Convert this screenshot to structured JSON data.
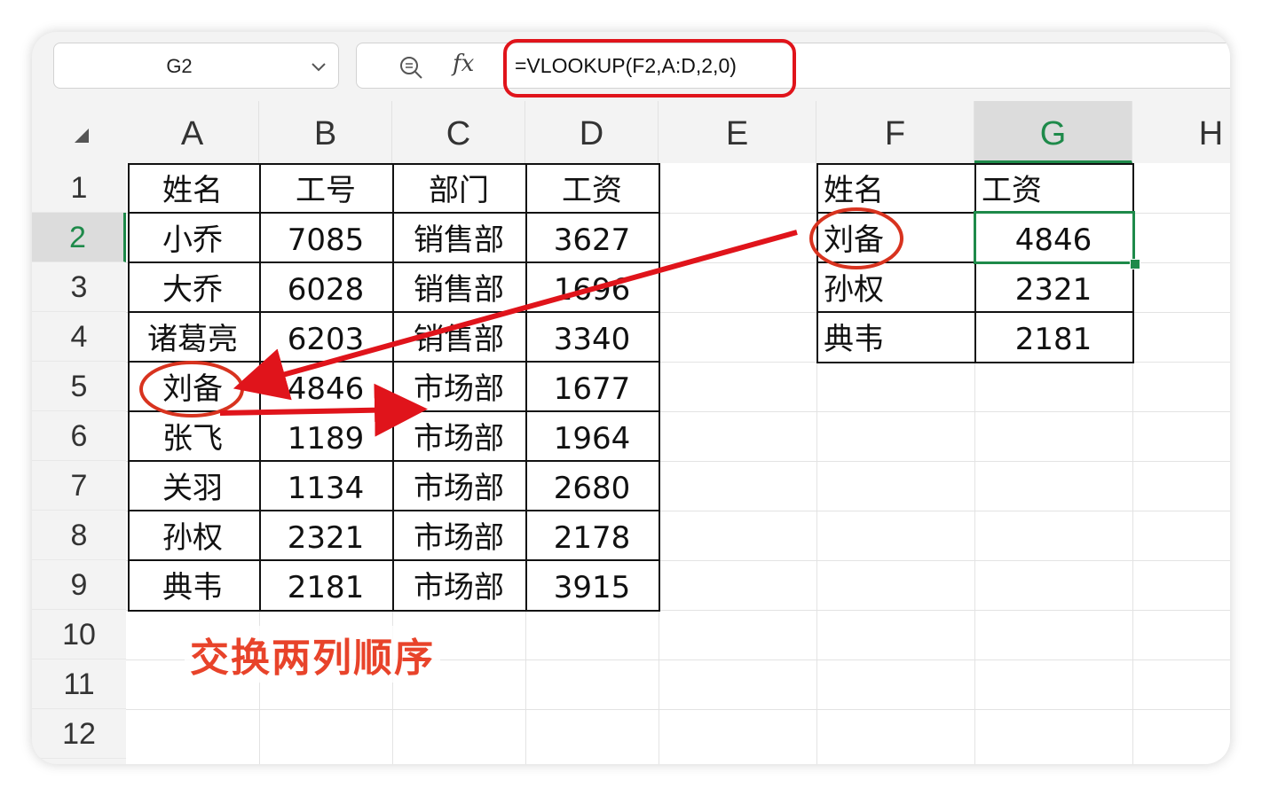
{
  "name_box": {
    "value": "G2"
  },
  "formula_bar": {
    "fx_label": "fx",
    "formula": "=VLOOKUP(F2,A:D,2,0)"
  },
  "columns": [
    {
      "label": "A"
    },
    {
      "label": "B"
    },
    {
      "label": "C"
    },
    {
      "label": "D"
    },
    {
      "label": "E"
    },
    {
      "label": "F"
    },
    {
      "label": "G"
    },
    {
      "label": "H"
    }
  ],
  "rows": [
    "1",
    "2",
    "3",
    "4",
    "5",
    "6",
    "7",
    "8",
    "9",
    "10",
    "11",
    "12"
  ],
  "active_cell": {
    "column": "G",
    "row": "2"
  },
  "left_table": {
    "headers": [
      "姓名",
      "工号",
      "部门",
      "工资"
    ],
    "rows": [
      [
        "小乔",
        "7085",
        "销售部",
        "3627"
      ],
      [
        "大乔",
        "6028",
        "销售部",
        "1696"
      ],
      [
        "诸葛亮",
        "6203",
        "销售部",
        "3340"
      ],
      [
        "刘备",
        "4846",
        "市场部",
        "1677"
      ],
      [
        "张飞",
        "1189",
        "市场部",
        "1964"
      ],
      [
        "关羽",
        "1134",
        "市场部",
        "2680"
      ],
      [
        "孙权",
        "2321",
        "市场部",
        "2178"
      ],
      [
        "典韦",
        "2181",
        "市场部",
        "3915"
      ]
    ]
  },
  "right_table": {
    "headers": [
      "姓名",
      "工资"
    ],
    "rows": [
      [
        "刘备",
        "4846"
      ],
      [
        "孙权",
        "2321"
      ],
      [
        "典韦",
        "2181"
      ]
    ]
  },
  "annotation": {
    "text": "交换两列顺序"
  },
  "colors": {
    "accent_green": "#1e8a4a",
    "annotation_red": "#e0141b"
  }
}
